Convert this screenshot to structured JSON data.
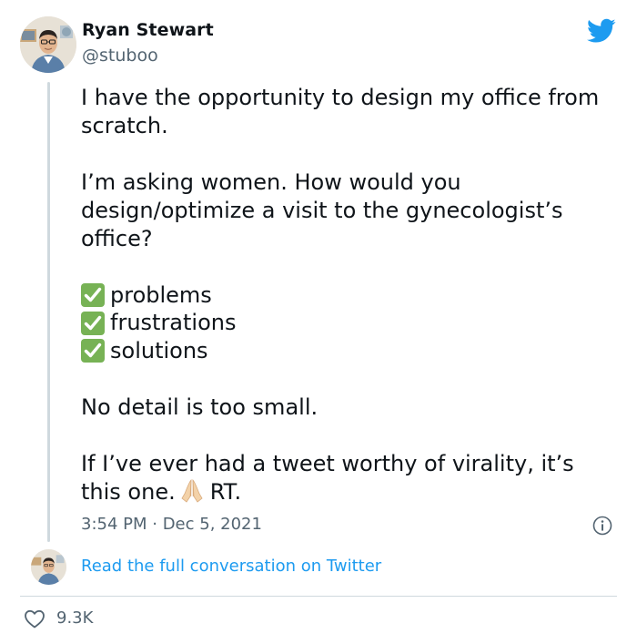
{
  "author": {
    "name": "Ryan Stewart",
    "handle": "@stuboo"
  },
  "tweet": {
    "paragraph1": "I have the opportunity to design my office from scratch.",
    "paragraph2": "I’m asking women. How would you design/optimize a visit to the gynecologist’s office?",
    "checklist": [
      "problems",
      "frustrations",
      "solutions"
    ],
    "paragraph3": "No detail is too small.",
    "paragraph4_before": "If I’ve ever had a tweet worthy of virality, it’s this one.",
    "paragraph4_after": "RT.",
    "emoji_icon": "folded-hands-icon",
    "timestamp": "3:54 PM · Dec 5, 2021"
  },
  "footer": {
    "read_link": "Read the full conversation on Twitter",
    "like_count": "9.3K"
  },
  "colors": {
    "link": "#1d9bf0",
    "secondary_text": "#536471",
    "check_green": "#77b255",
    "twitter_blue": "#1d9bf0"
  },
  "icons": [
    "twitter-bird-icon",
    "info-icon",
    "heart-icon",
    "check-mark-icon",
    "folded-hands-icon"
  ]
}
